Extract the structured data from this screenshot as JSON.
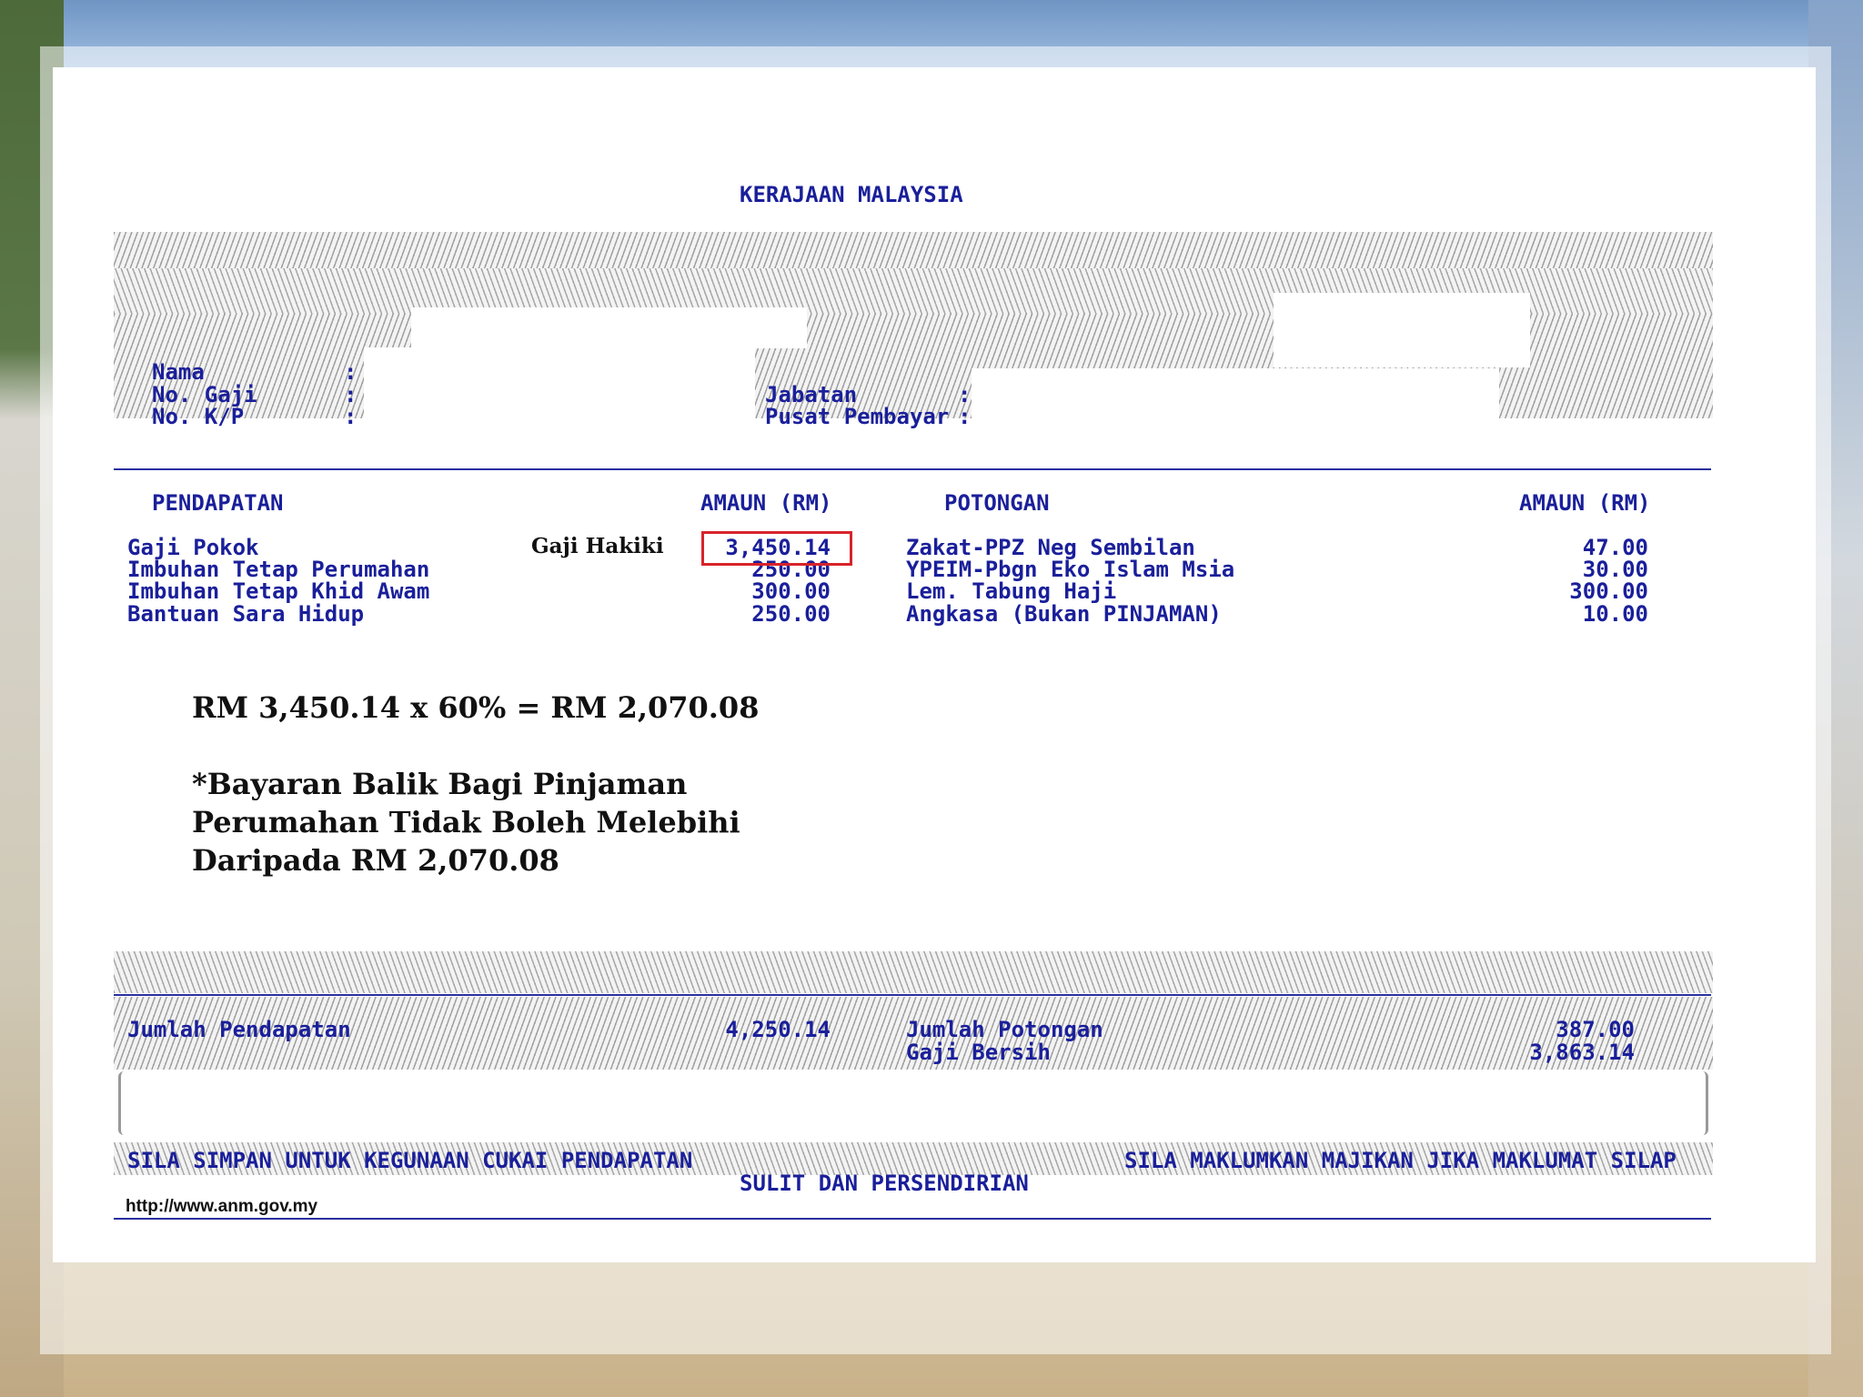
{
  "header": {
    "title": "KERAJAAN MALAYSIA"
  },
  "identity": {
    "nama_label": "Nama",
    "no_gaji_label": "No. Gaji",
    "no_kp_label": "No. K/P",
    "colon": ":",
    "jabatan_label": "Jabatan",
    "pusat_pembayar_label": "Pusat Pembayar"
  },
  "earnings": {
    "heading": "PENDAPATAN",
    "amount_heading": "AMAUN (RM)",
    "items": [
      {
        "label": "Gaji Pokok",
        "amount": "3,450.14"
      },
      {
        "label": "Imbuhan Tetap Perumahan",
        "amount": "250.00"
      },
      {
        "label": "Imbuhan Tetap Khid Awam",
        "amount": "300.00"
      },
      {
        "label": "Bantuan Sara Hidup",
        "amount": "250.00"
      }
    ],
    "highlight_label": "Gaji Hakiki"
  },
  "deductions": {
    "heading": "POTONGAN",
    "amount_heading": "AMAUN (RM)",
    "items": [
      {
        "label": "Zakat-PPZ Neg Sembilan",
        "amount": "47.00"
      },
      {
        "label": "YPEIM-Pbgn Eko Islam Msia",
        "amount": "30.00"
      },
      {
        "label": "Lem. Tabung Haji",
        "amount": "300.00"
      },
      {
        "label": "Angkasa (Bukan PINJAMAN)",
        "amount": "10.00"
      }
    ]
  },
  "annotation": {
    "formula": "RM 3,450.14 x 60% = RM 2,070.08",
    "note_lines": [
      "*Bayaran Balik Bagi Pinjaman",
      "Perumahan Tidak Boleh Melebihi",
      "Daripada RM 2,070.08"
    ]
  },
  "totals": {
    "jumlah_pendapatan_label": "Jumlah Pendapatan",
    "jumlah_pendapatan": "4,250.14",
    "jumlah_potongan_label": "Jumlah Potongan",
    "jumlah_potongan": "387.00",
    "gaji_bersih_label": "Gaji Bersih",
    "gaji_bersih": "3,863.14"
  },
  "footer": {
    "left": "SILA SIMPAN UNTUK KEGUNAAN CUKAI PENDAPATAN",
    "right": "SILA MAKLUMKAN MAJIKAN JIKA MAKLUMAT SILAP",
    "center": "SULIT DAN PERSENDIRIAN",
    "url": "http://www.anm.gov.my"
  },
  "colors": {
    "ink": "#1a1f9a",
    "highlight_box": "#d8232a"
  }
}
